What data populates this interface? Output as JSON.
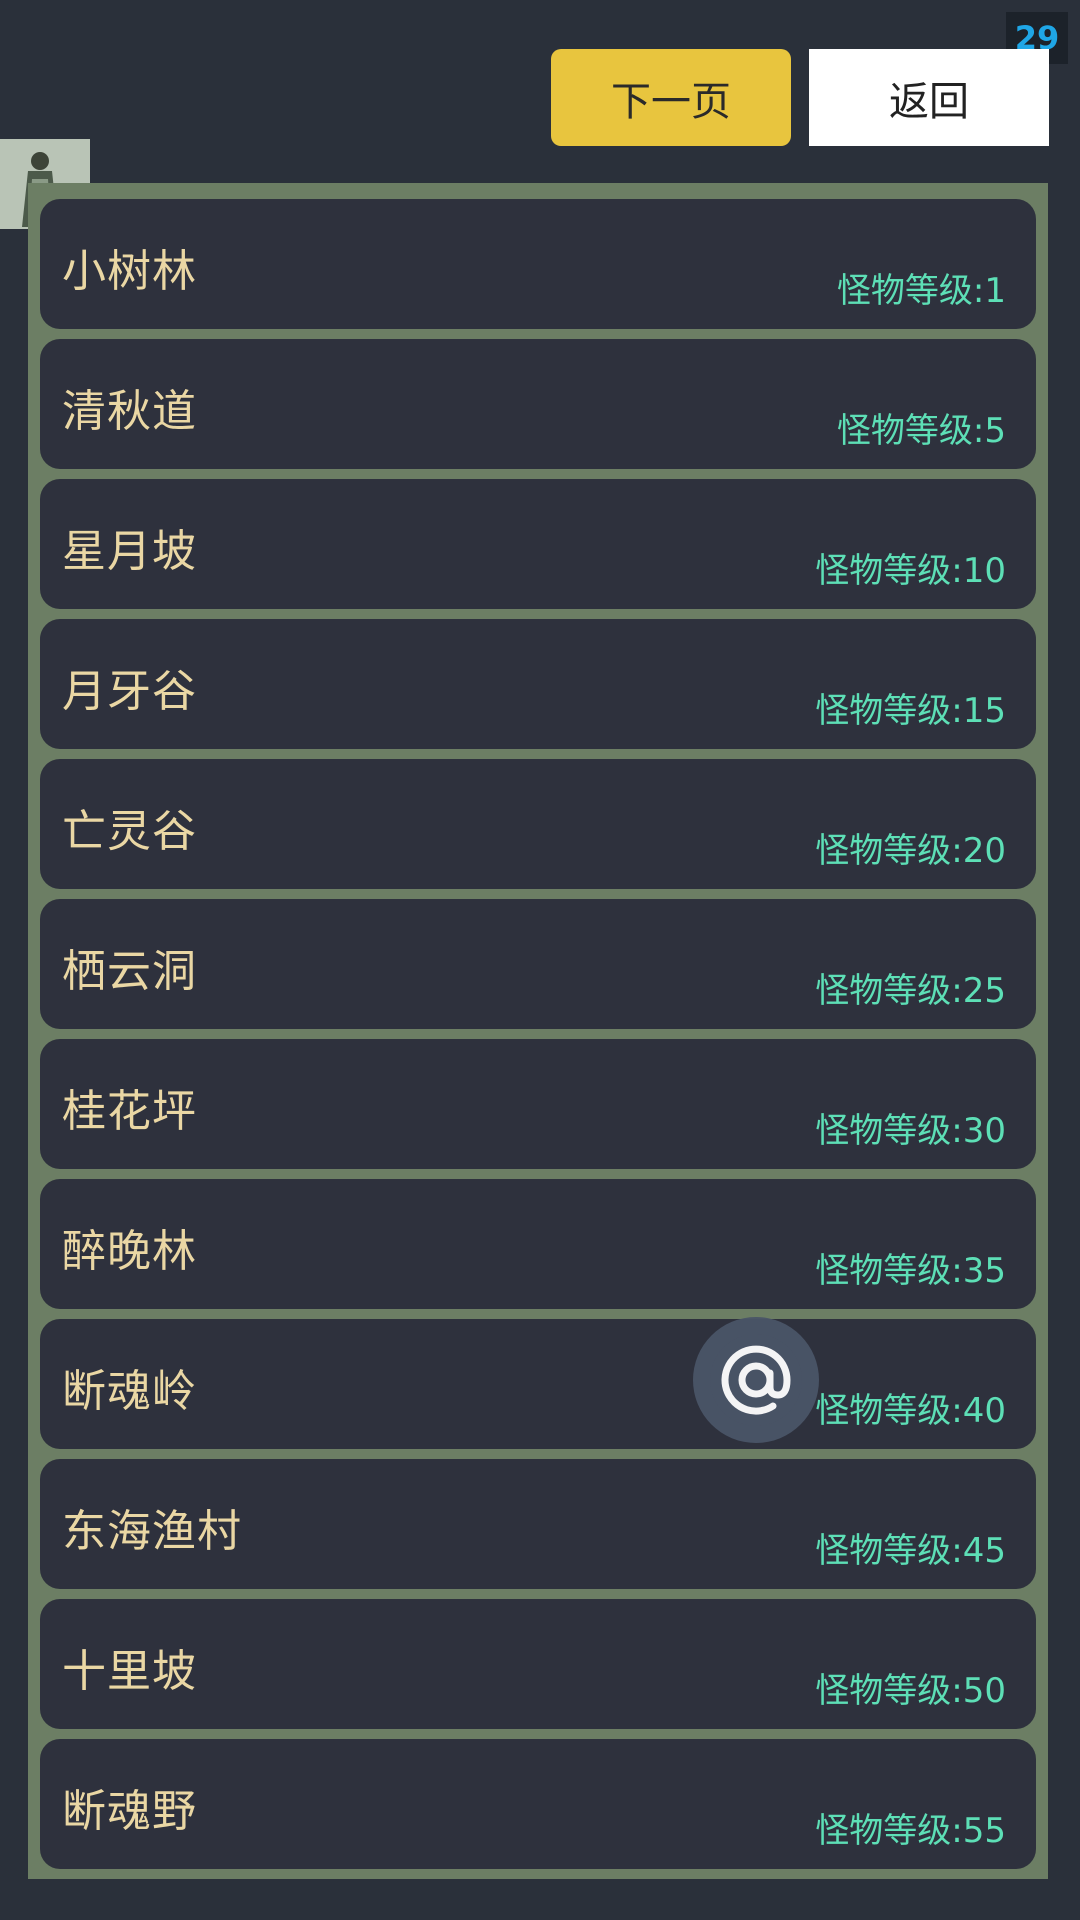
{
  "top_bar": {
    "counter": "29",
    "next_label": "下一页",
    "back_label": "返回"
  },
  "maps": [
    {
      "name": "小树林",
      "level": "怪物等级:1"
    },
    {
      "name": "清秋道",
      "level": "怪物等级:5"
    },
    {
      "name": "星月坡",
      "level": "怪物等级:10"
    },
    {
      "name": "月牙谷",
      "level": "怪物等级:15"
    },
    {
      "name": "亡灵谷",
      "level": "怪物等级:20"
    },
    {
      "name": "栖云洞",
      "level": "怪物等级:25"
    },
    {
      "name": "桂花坪",
      "level": "怪物等级:30"
    },
    {
      "name": "醉晚林",
      "level": "怪物等级:35"
    },
    {
      "name": "断魂岭",
      "level": "怪物等级:40"
    },
    {
      "name": "东海渔村",
      "level": "怪物等级:45"
    },
    {
      "name": "十里坡",
      "level": "怪物等级:50"
    },
    {
      "name": "断魂野",
      "level": "怪物等级:55"
    }
  ],
  "icons": {
    "float": "at-icon",
    "avatar": "character-avatar"
  },
  "colors": {
    "accent": "#e8c53e",
    "level_text": "#5ddfb6",
    "name_text": "#ead7a4",
    "panel_border": "#6c7e64"
  }
}
